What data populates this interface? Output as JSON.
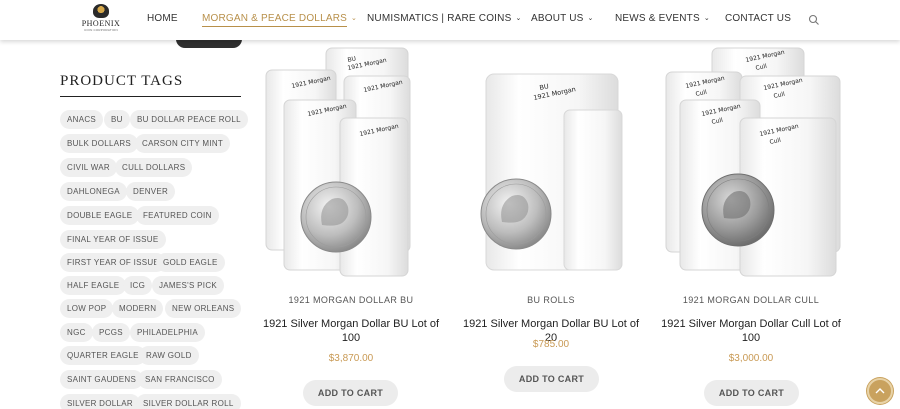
{
  "brand": {
    "name": "PHOENIX",
    "sub": "COIN CORPORATION"
  },
  "nav": {
    "items": [
      {
        "label": "HOME",
        "dropdown": false
      },
      {
        "label": "MORGAN & PEACE DOLLARS",
        "dropdown": true,
        "active": true
      },
      {
        "label": "NUMISMATICS | RARE COINS",
        "dropdown": true
      },
      {
        "label": "ABOUT US",
        "dropdown": true
      },
      {
        "label": "NEWS & EVENTS",
        "dropdown": true
      },
      {
        "label": "CONTACT US",
        "dropdown": false
      }
    ],
    "search_icon": "search-icon",
    "accent_color": "#b8904a"
  },
  "sidebar": {
    "title": "PRODUCT TAGS",
    "tags": [
      "ANACS",
      "BU",
      "BU DOLLAR PEACE ROLL",
      "BULK DOLLARS",
      "CARSON CITY MINT",
      "CIVIL WAR",
      "CULL DOLLARS",
      "DAHLONEGA",
      "DENVER",
      "DOUBLE EAGLE",
      "FEATURED COIN",
      "FINAL YEAR OF ISSUE",
      "FIRST YEAR OF ISSUE",
      "GOLD EAGLE",
      "HALF EAGLE",
      "ICG",
      "JAMES'S PICK",
      "LOW POP",
      "MODERN",
      "NEW ORLEANS",
      "NGC",
      "PCGS",
      "PHILADELPHIA",
      "QUARTER EAGLE",
      "RAW GOLD",
      "SAINT GAUDENS",
      "SAN FRANCISCO",
      "SILVER DOLLAR",
      "SILVER DOLLAR ROLL"
    ]
  },
  "products": [
    {
      "category": "1921 MORGAN DOLLAR BU",
      "title": "1921 Silver Morgan Dollar BU Lot of 100",
      "price": "$3,870.00",
      "cart_label": "ADD TO CART",
      "tube_labels": [
        "BU 1921 Morgan"
      ]
    },
    {
      "category": "BU ROLLS",
      "title": "1921 Silver Morgan Dollar BU Lot of 20",
      "price": "$785.00",
      "cart_label": "ADD TO CART",
      "tube_labels": [
        "BU 1921 Morgan"
      ]
    },
    {
      "category": "1921 MORGAN DOLLAR CULL",
      "title": "1921 Silver Morgan Dollar Cull Lot of 100",
      "price": "$3,000.00",
      "cart_label": "ADD TO CART",
      "tube_labels": [
        "1921 Morgan Cull"
      ]
    }
  ],
  "colors": {
    "price": "#c99a55",
    "tag_bg": "#efefef",
    "scroll_top": "#c9a25e"
  }
}
